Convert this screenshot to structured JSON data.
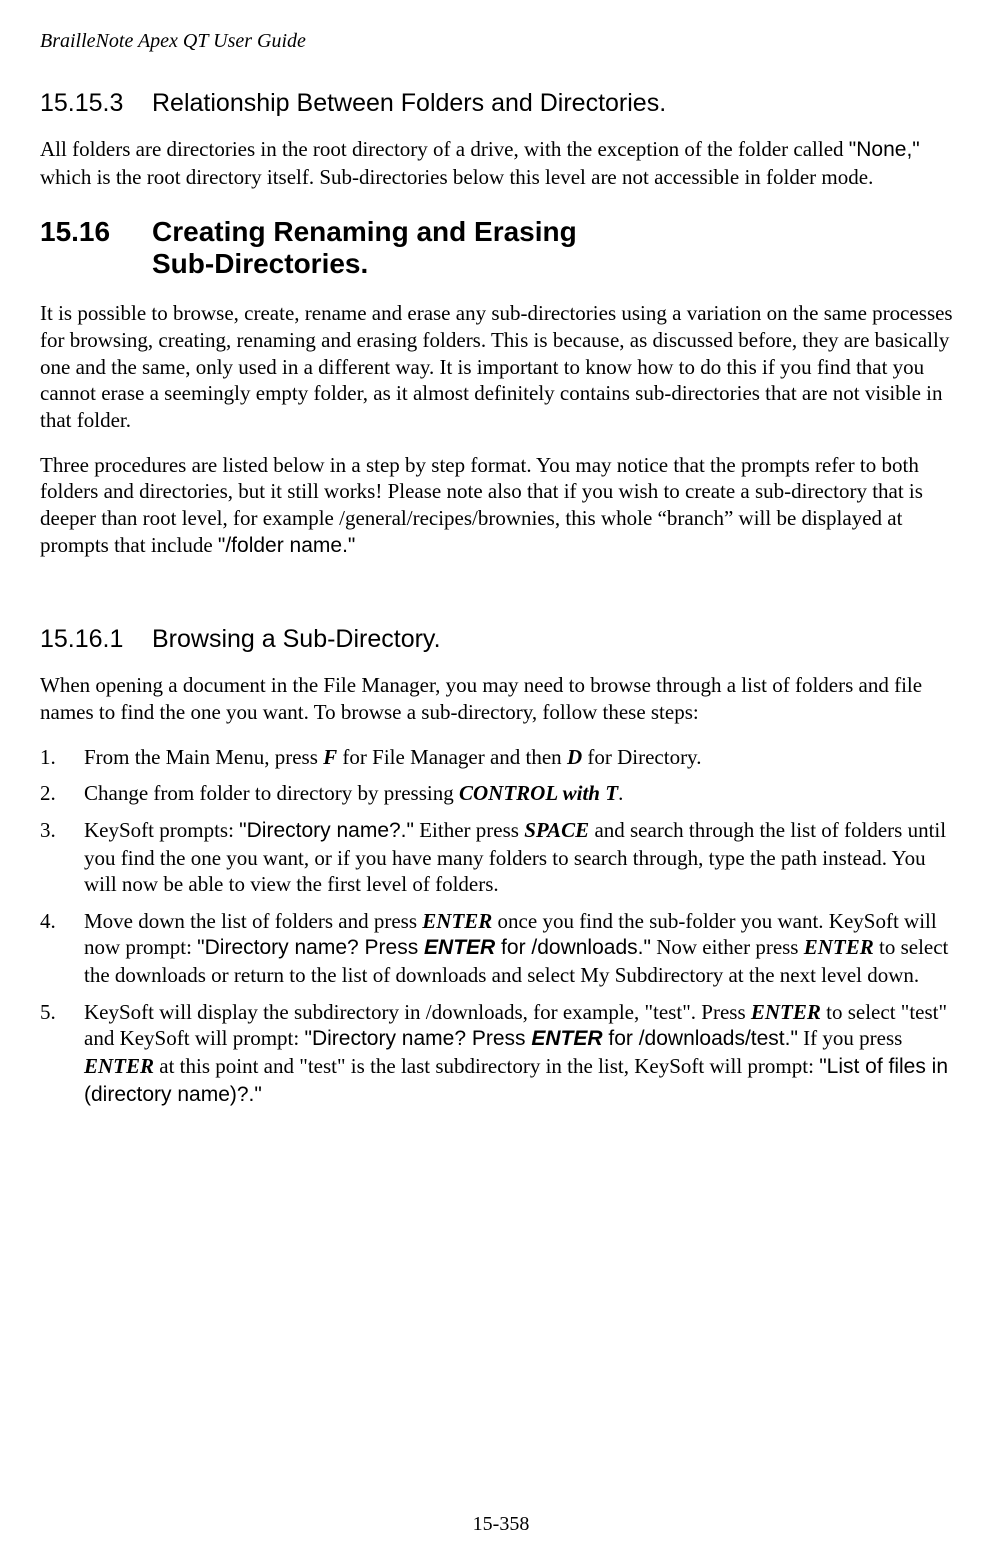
{
  "header": {
    "title": "BrailleNote Apex QT User Guide"
  },
  "section_15_15_3": {
    "number": "15.15.3",
    "title": "Relationship Between Folders and Directories.",
    "para1_a": "All folders are directories in the root directory of a drive, with the exception of the folder called ",
    "para1_bold": "\"None,\"",
    "para1_b": " which is the root directory itself. Sub-directories below this level are not accessible in folder mode."
  },
  "section_15_16": {
    "number": "15.16",
    "title_line1": "Creating Renaming and Erasing",
    "title_line2": "Sub-Directories.",
    "para1": "It is possible to browse, create, rename and erase any sub-directories using a variation on the same processes for browsing, creating, renaming and erasing folders. This is because, as discussed before, they are basically one and the same, only used in a different way. It is important to know how to do this if you find that you cannot erase a seemingly empty folder, as it almost definitely contains sub-directories that are not visible in that folder.",
    "para2_a": "Three procedures are listed below in a step by step format. You may notice that the prompts refer to both folders and directories, but it still works! Please note also that if you wish to create a sub-directory that is deeper than root level, for example /general/recipes/brownies, this whole “branch” will be displayed at prompts that include ",
    "para2_bold": "\"/folder name.\""
  },
  "section_15_16_1": {
    "number": "15.16.1",
    "title": "Browsing a Sub-Directory.",
    "intro": "When opening a document in the File Manager, you may need to browse through a list of folders and file names to find the one you want. To browse a sub-directory, follow these steps:",
    "steps": {
      "s1_num": "1.",
      "s1_a": "From the Main Menu, press ",
      "s1_key1": "F",
      "s1_b": " for File Manager and then ",
      "s1_key2": "D",
      "s1_c": " for Directory.",
      "s2_num": "2.",
      "s2_a": "Change from folder to directory by pressing ",
      "s2_key1": "CONTROL with T",
      "s2_b": ".",
      "s3_num": "3.",
      "s3_a": "KeySoft prompts: ",
      "s3_prompt": "\"Directory name?.\"",
      "s3_b": " Either press ",
      "s3_key1": "SPACE",
      "s3_c": " and search through the list of folders until you find the one you want, or if you have many folders to search through, type the path instead. You will now be able to view the first level of folders.",
      "s4_num": "4.",
      "s4_a": " Move down the list of folders and press ",
      "s4_key1": "ENTER",
      "s4_b": " once you find the sub-folder you want. KeySoft will now prompt: ",
      "s4_prompt_a": "\"Directory name? Press ",
      "s4_prompt_key": "ENTER",
      "s4_prompt_b": " for /downloads.\"",
      "s4_c": " Now either press ",
      "s4_key2": "ENTER",
      "s4_d": " to select the downloads or return to the list of downloads and select My Subdirectory at the next level down.",
      "s5_num": "5.",
      "s5_a": "KeySoft will display the subdirectory in /downloads, for example, \"test\". Press ",
      "s5_key1": "ENTER",
      "s5_b": " to select \"test\" and KeySoft will prompt: ",
      "s5_prompt_a": "\"Directory name? Press ",
      "s5_prompt_key": "ENTER",
      "s5_prompt_b": " for /downloads/test.\"",
      "s5_c": " If you press ",
      "s5_key2": "ENTER",
      "s5_d": " at this point and \"test\" is the last subdirectory in the list, KeySoft will prompt: ",
      "s5_prompt2": "\"List of files in (directory name)?.\""
    }
  },
  "page_number": "15-358"
}
